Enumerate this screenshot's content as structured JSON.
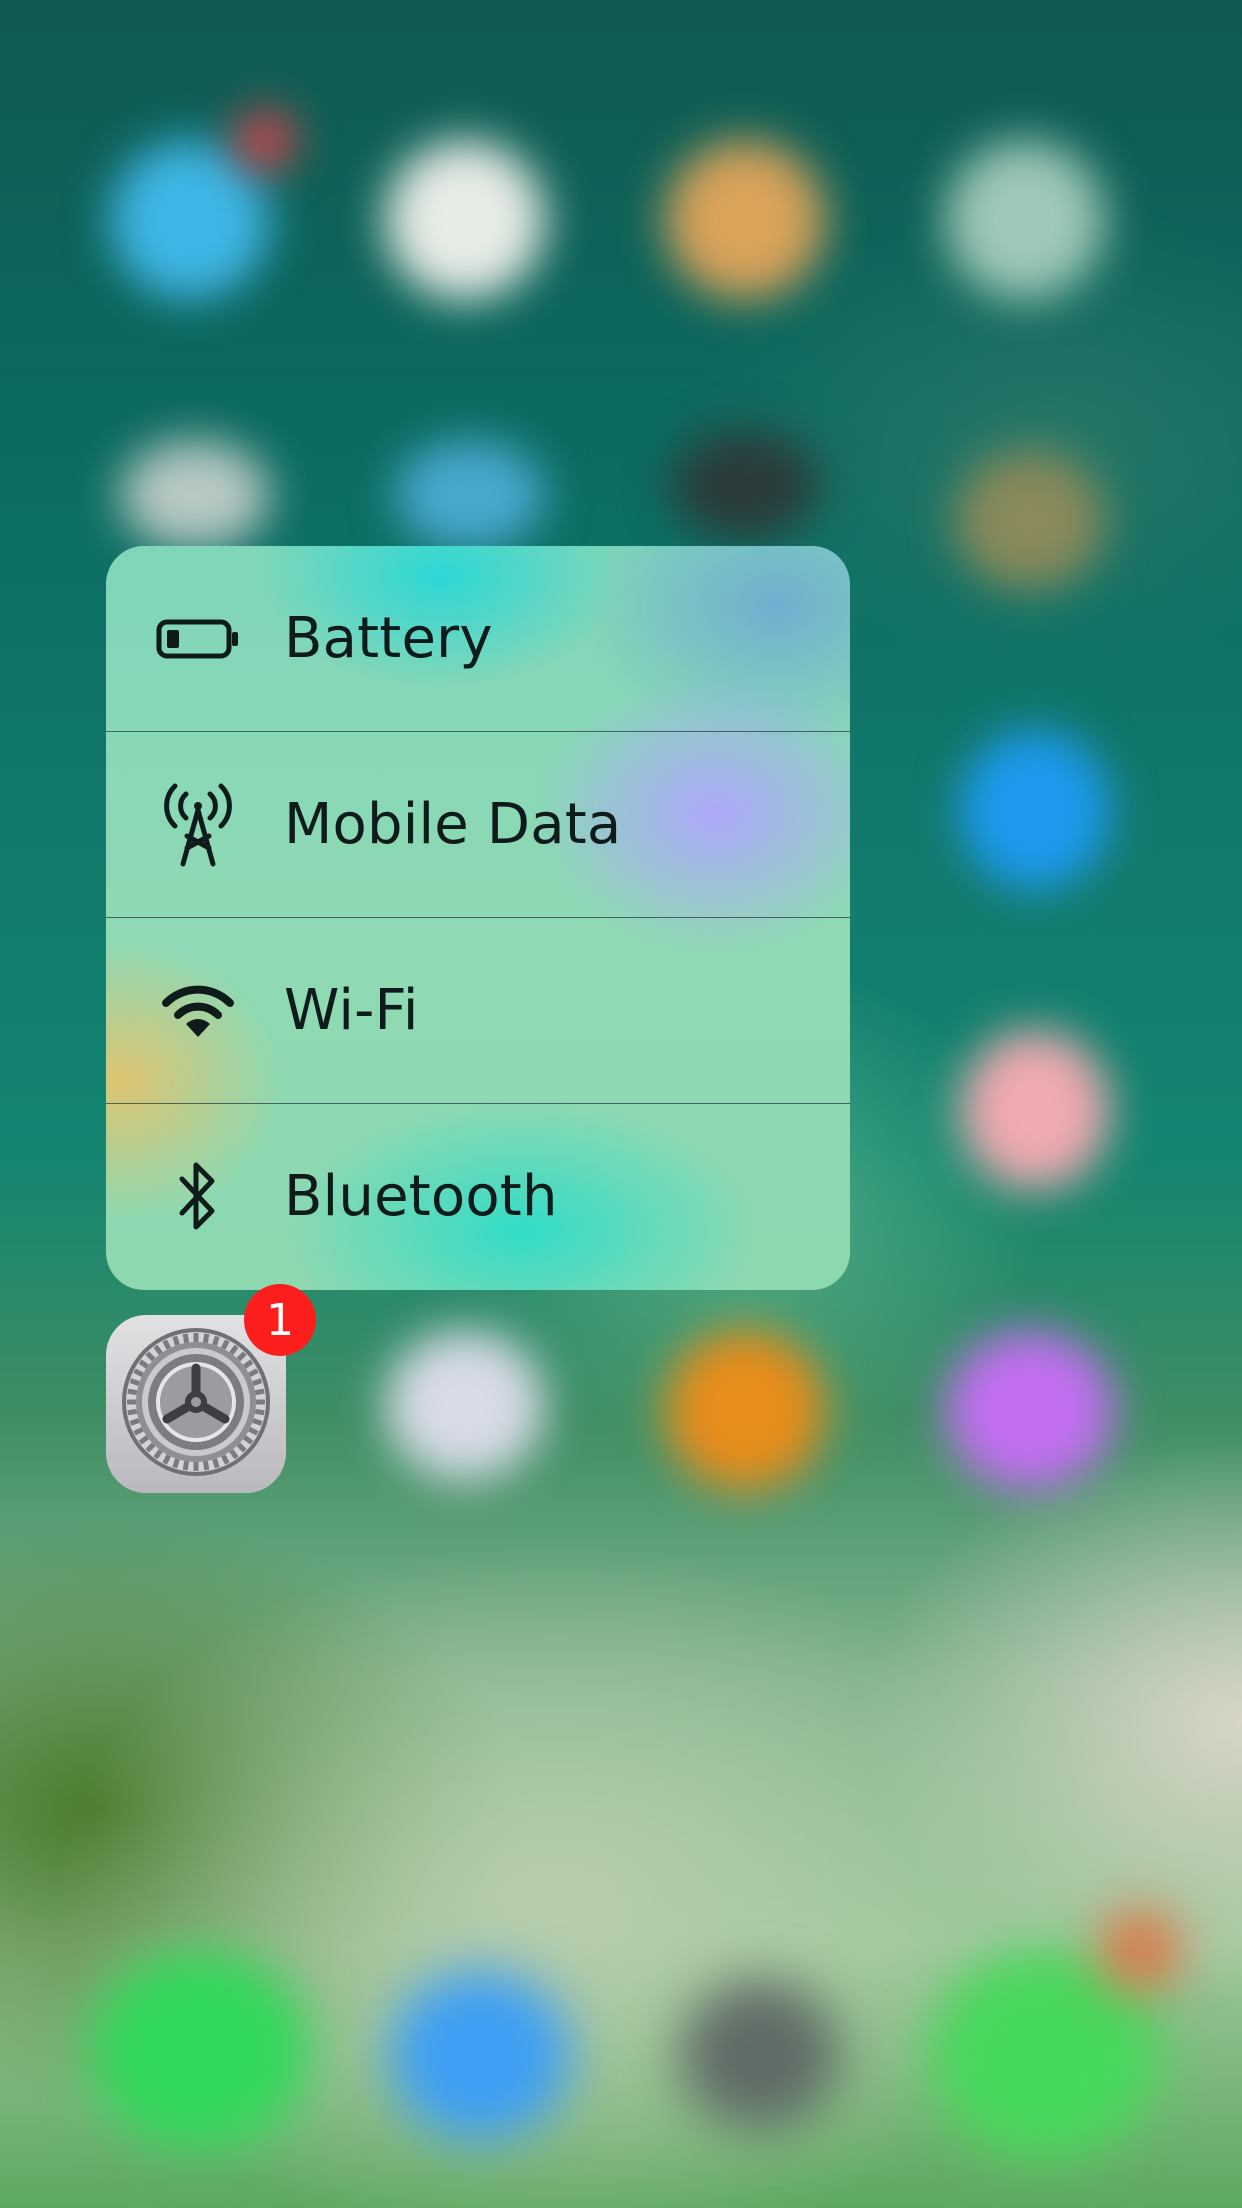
{
  "quick_actions": {
    "items": [
      {
        "label": "Battery",
        "icon": "battery-icon"
      },
      {
        "label": "Mobile Data",
        "icon": "cellular-antenna-icon"
      },
      {
        "label": "Wi-Fi",
        "icon": "wifi-icon"
      },
      {
        "label": "Bluetooth",
        "icon": "bluetooth-icon"
      }
    ]
  },
  "app": {
    "icon": "settings-gear-icon",
    "badge_count": "1"
  },
  "colors": {
    "badge": "#fc1d1d",
    "label_text": "#0e1b1a"
  }
}
